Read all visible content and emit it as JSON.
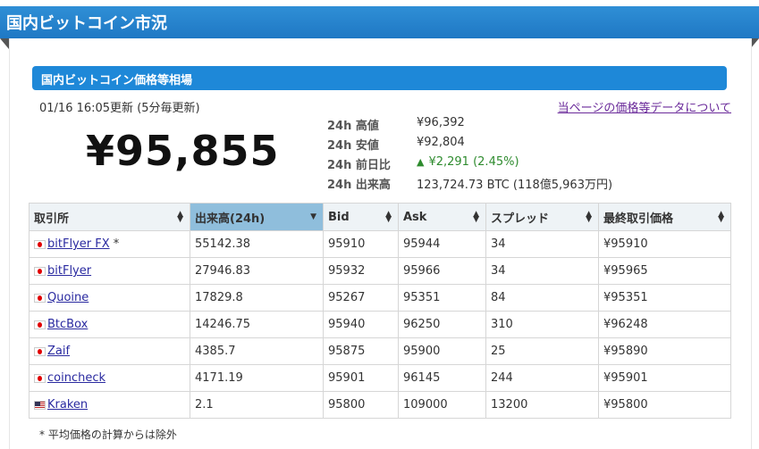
{
  "header": {
    "title": "国内ビットコイン市況"
  },
  "section": {
    "title": "国内ビットコイン価格等相場"
  },
  "updated": "01/16 16:05更新 (5分毎更新)",
  "about_link": "当ページの価格等データについて",
  "price": "¥95,855",
  "stats": [
    {
      "label": "24h 高値",
      "value": "¥96,392",
      "trend": ""
    },
    {
      "label": "24h 安値",
      "value": "¥92,804",
      "trend": ""
    },
    {
      "label": "24h 前日比",
      "value": "¥2,291 (2.45%)",
      "trend": "up",
      "icon": "triangle-up"
    },
    {
      "label": "24h 出来高",
      "value": "123,724.73 BTC (118億5,963万円)",
      "trend": ""
    }
  ],
  "table": {
    "columns": [
      "取引所",
      "出来高(24h)",
      "Bid",
      "Ask",
      "スプレッド",
      "最終取引価格"
    ],
    "rows": [
      {
        "flag": "jp",
        "exchange": "bitFlyer FX",
        "mark": "*",
        "volume": "55142.38",
        "bid": "95910",
        "ask": "95944",
        "spread": "34",
        "last": "¥95910"
      },
      {
        "flag": "jp",
        "exchange": "bitFlyer",
        "mark": "",
        "volume": "27946.83",
        "bid": "95932",
        "ask": "95966",
        "spread": "34",
        "last": "¥95965"
      },
      {
        "flag": "jp",
        "exchange": "Quoine",
        "mark": "",
        "volume": "17829.8",
        "bid": "95267",
        "ask": "95351",
        "spread": "84",
        "last": "¥95351"
      },
      {
        "flag": "jp",
        "exchange": "BtcBox",
        "mark": "",
        "volume": "14246.75",
        "bid": "95940",
        "ask": "96250",
        "spread": "310",
        "last": "¥96248"
      },
      {
        "flag": "jp",
        "exchange": "Zaif",
        "mark": "",
        "volume": "4385.7",
        "bid": "95875",
        "ask": "95900",
        "spread": "25",
        "last": "¥95890"
      },
      {
        "flag": "jp",
        "exchange": "coincheck",
        "mark": "",
        "volume": "4171.19",
        "bid": "95901",
        "ask": "96145",
        "spread": "244",
        "last": "¥95901"
      },
      {
        "flag": "us",
        "exchange": "Kraken",
        "mark": "",
        "volume": "2.1",
        "bid": "95800",
        "ask": "109000",
        "spread": "13200",
        "last": "¥95800"
      }
    ]
  },
  "note": "* 平均価格の計算からは除外",
  "colors": {
    "header": "#1f78c4",
    "section": "#1e88d8",
    "active_column": "#8fbedc",
    "up": "#2e8b2e"
  }
}
